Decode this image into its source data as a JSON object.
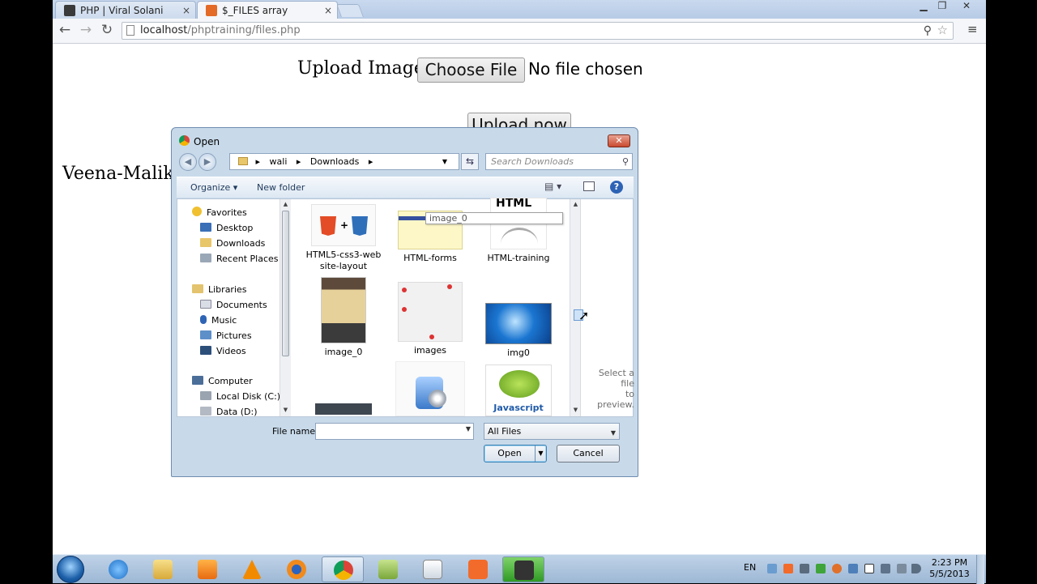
{
  "browser": {
    "tabs": [
      {
        "title": "PHP | Viral Solani",
        "close": "×",
        "color": "#3a3a3a"
      },
      {
        "title": "$_FILES array",
        "close": "×",
        "color": "#e36a27"
      }
    ],
    "url_host": "localhost",
    "url_path": "/phptraining/files.php"
  },
  "page": {
    "upload_label": "Upload Image:",
    "choose_file": "Choose File",
    "file_status": "No file chosen",
    "upload_button": "Upload now",
    "left_text": "Veena-Malik-"
  },
  "dialog": {
    "title": "Open",
    "breadcrumb": [
      "wali",
      "Downloads"
    ],
    "search_placeholder": "Search Downloads",
    "organize": "Organize ▾",
    "new_folder": "New folder",
    "nav": {
      "favorites": "Favorites",
      "desktop": "Desktop",
      "downloads": "Downloads",
      "recent": "Recent Places",
      "libraries": "Libraries",
      "documents": "Documents",
      "music": "Music",
      "pictures": "Pictures",
      "videos": "Videos",
      "computer": "Computer",
      "local_disk": "Local Disk (C:)",
      "data_disk": "Data (D:)"
    },
    "files": [
      {
        "name": "HTML5-css3-web site-layout"
      },
      {
        "name": "HTML-forms"
      },
      {
        "name": "HTML-training"
      },
      {
        "name": "image_0"
      },
      {
        "name": "images"
      },
      {
        "name": "img0"
      }
    ],
    "html_logo_text": "HTML",
    "javascript_text": "Javascript",
    "tooltip": "image_0",
    "preview_hint_1": "Select a file",
    "preview_hint_2": "to preview.",
    "file_name_label": "File name:",
    "file_name_value": "",
    "file_type": "All Files",
    "open": "Open",
    "cancel": "Cancel"
  },
  "taskbar": {
    "lang": "EN",
    "time": "2:23 PM",
    "date": "5/5/2013"
  }
}
